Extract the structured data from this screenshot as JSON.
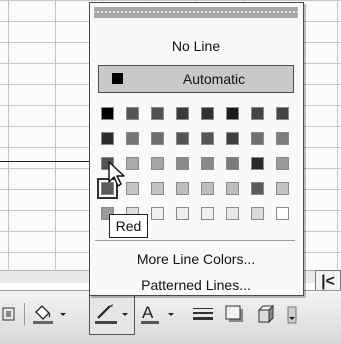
{
  "line_color_menu": {
    "no_line_label": "No Line",
    "automatic_label": "Automatic",
    "more_colors_label": "More Line Colors...",
    "patterned_lines_label": "Patterned Lines...",
    "tooltip": "Red",
    "hovered_swatch_index": 24,
    "swatches": [
      "#000000",
      "#555555",
      "#505050",
      "#3a3a3a",
      "#303030",
      "#1a1a1a",
      "#444444",
      "#444444",
      "#2b2b2b",
      "#777777",
      "#6e6e6e",
      "#555555",
      "#555555",
      "#3f3f3f",
      "#707070",
      "#7d7d7d",
      "#555555",
      "#aaaaaa",
      "#a5a5a5",
      "#8a8a8a",
      "#888888",
      "#7a7a7a",
      "#2a2a2a",
      "#9a9a9a",
      "#5a5a5a",
      "#c4c4c4",
      "#c2c2c2",
      "#bdbdbd",
      "#bdbdbd",
      "#bdbdbd",
      "#5a5a5a",
      "#c2c2c2",
      "#9a9a9a",
      "#e0e0e0",
      "#f1f1f1",
      "#eeeeee",
      "#f0f0f0",
      "#e8e8e8",
      "#dadada",
      "#ffffff"
    ]
  },
  "toolbar": {
    "items": [
      "3d-shadow-icon",
      "fill-color-icon",
      "line-color-icon",
      "font-color-icon",
      "line-style-icon",
      "shadow-style-icon",
      "3d-style-icon",
      "toolbar-options-icon"
    ]
  },
  "scrollbar": {
    "left_arrow": "|<"
  }
}
